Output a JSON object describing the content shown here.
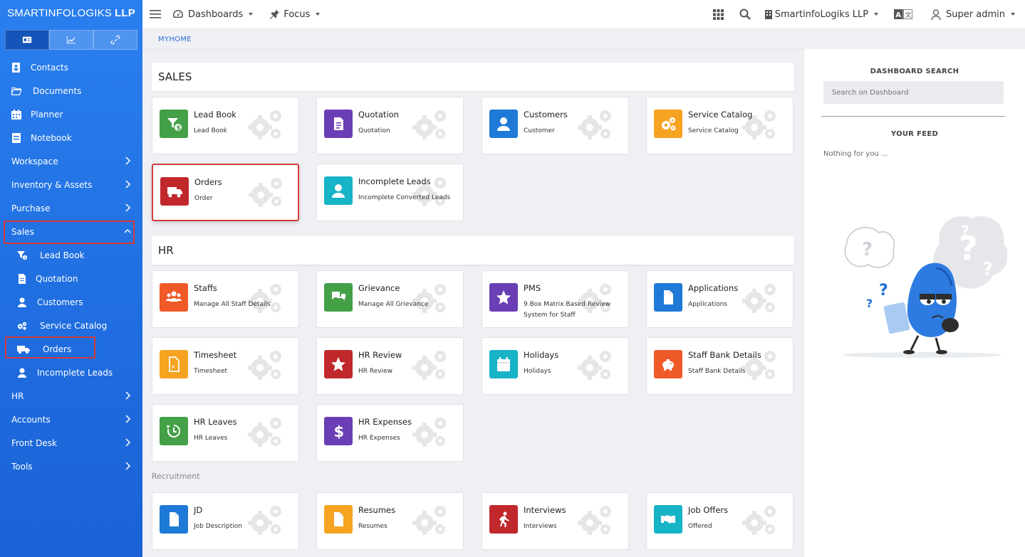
{
  "brand": {
    "name_light": "SMARTINFOLOGIKS",
    "name_bold": "LLP"
  },
  "topbar": {
    "dashboards": "Dashboards",
    "focus": "Focus",
    "company": "SmartinfoLogiks LLP",
    "user": "Super admin"
  },
  "breadcrumb": "MYHOME",
  "sidebar": {
    "items": [
      {
        "label": "Contacts",
        "icon": "contacts-icon"
      },
      {
        "label": "Documents",
        "icon": "folder-icon"
      },
      {
        "label": "Planner",
        "icon": "calendar-icon"
      },
      {
        "label": "Notebook",
        "icon": "notebook-icon"
      },
      {
        "label": "Workspace"
      },
      {
        "label": "Inventory & Assets"
      },
      {
        "label": "Purchase"
      },
      {
        "label": "Sales"
      },
      {
        "label": "Lead Book",
        "icon": "lead-funnel-icon"
      },
      {
        "label": "Quotation",
        "icon": "document-icon"
      },
      {
        "label": "Customers",
        "icon": "user-icon"
      },
      {
        "label": "Service Catalog",
        "icon": "gears-icon"
      },
      {
        "label": "Orders",
        "icon": "truck-icon"
      },
      {
        "label": "Incomplete Leads",
        "icon": "user-icon"
      },
      {
        "label": "HR"
      },
      {
        "label": "Accounts"
      },
      {
        "label": "Front Desk"
      },
      {
        "label": "Tools"
      }
    ]
  },
  "sections": {
    "sales": "SALES",
    "hr": "HR",
    "recruitment": "Recruitment"
  },
  "cards": [
    {
      "title": "Lead Book",
      "sub": "Lead Book",
      "color": "#43a047",
      "icon": "funnel-dollar-icon"
    },
    {
      "title": "Quotation",
      "sub": "Quotation",
      "color": "#6a3fb5",
      "icon": "document-icon"
    },
    {
      "title": "Customers",
      "sub": "Customer",
      "color": "#1e7ad6",
      "icon": "user-icon"
    },
    {
      "title": "Service Catalog",
      "sub": "Service Catalog",
      "color": "#f5a321",
      "icon": "gears-icon"
    },
    {
      "title": "Orders",
      "sub": "Order",
      "color": "#c0282c",
      "icon": "truck-icon"
    },
    {
      "title": "Incomplete Leads",
      "sub": "Incomplete Converted Leads",
      "color": "#17b3c7",
      "icon": "user-icon"
    },
    {
      "title": "Staffs",
      "sub": "Manage All Staff Details",
      "color": "#f05a28",
      "icon": "users-icon"
    },
    {
      "title": "Grievance",
      "sub": "Manage All Grievance",
      "color": "#43a047",
      "icon": "chat-icon"
    },
    {
      "title": "PMS",
      "sub": "9 Box Matrix Based Review System for Staff",
      "color": "#6a3fb5",
      "icon": "star-icon"
    },
    {
      "title": "Applications",
      "sub": "Applications",
      "color": "#1e7ad6",
      "icon": "file-icon"
    },
    {
      "title": "Timesheet",
      "sub": "Timesheet",
      "color": "#f5a321",
      "icon": "excel-file-icon"
    },
    {
      "title": "HR Review",
      "sub": "HR Review",
      "color": "#c0282c",
      "icon": "star-icon"
    },
    {
      "title": "Holidays",
      "sub": "Holidays",
      "color": "#17b3c7",
      "icon": "calendar-icon"
    },
    {
      "title": "Staff Bank Details",
      "sub": "Staff Bank Details",
      "color": "#f05a28",
      "icon": "piggy-bank-icon"
    },
    {
      "title": "HR Leaves",
      "sub": "HR Leaves",
      "color": "#43a047",
      "icon": "history-icon"
    },
    {
      "title": "HR Expenses",
      "sub": "HR Expenses",
      "color": "#6a3fb5",
      "icon": "dollar-icon"
    },
    {
      "title": "JD",
      "sub": "Job Description",
      "color": "#1e7ad6",
      "icon": "file-icon"
    },
    {
      "title": "Resumes",
      "sub": "Resumes",
      "color": "#f5a321",
      "icon": "file-icon"
    },
    {
      "title": "Interviews",
      "sub": "Interviews",
      "color": "#c0282c",
      "icon": "walking-icon"
    },
    {
      "title": "Job Offers",
      "sub": "Offered",
      "color": "#17b3c7",
      "icon": "handshake-icon"
    }
  ],
  "right_panel": {
    "search_title": "DASHBOARD SEARCH",
    "search_placeholder": "Search on Dashboard",
    "feed_title": "YOUR FEED",
    "feed_empty": "Nothing for you ..."
  }
}
